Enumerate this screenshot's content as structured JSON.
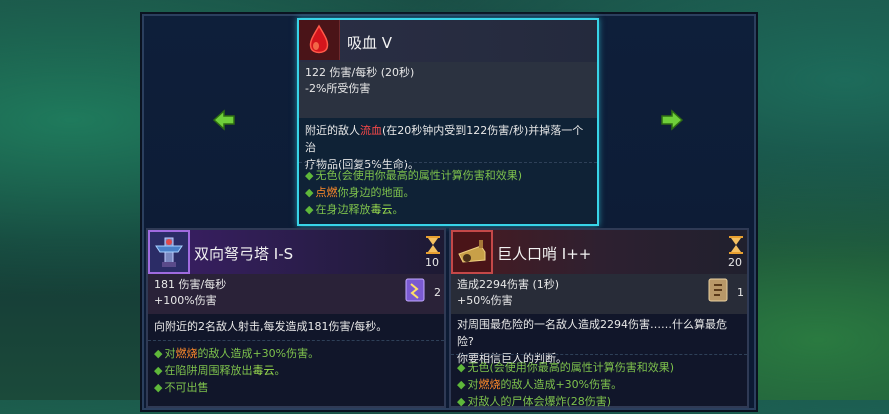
{
  "top_card": {
    "title": "吸血 V",
    "stat_line1": "122 伤害/每秒 (20秒)",
    "stat_line2": "-2%所受伤害",
    "desc_pre": "附近的敌人",
    "desc_hl": "流血",
    "desc_post": "(在20秒钟内受到122伤害/秒)并掉落一个治",
    "desc_line2": "疗物品(回复5%生命)。",
    "effects": [
      {
        "pre": "",
        "hl": "",
        "text": "无色(会使用你最高的属性计算伤害和效果)"
      },
      {
        "pre": "",
        "hl": "点燃",
        "text": "你身边的地面。"
      },
      {
        "pre": "在身边释放",
        "hl": "毒云",
        "text": "。"
      }
    ]
  },
  "bottom_left": {
    "title": "双向弩弓塔 I-S",
    "cooldown": "10",
    "stat_line1": "181 伤害/每秒",
    "stat_line2": "+100%伤害",
    "scroll_count": "2",
    "desc": "向附近的2名敌人射击,每发造成181伤害/每秒。",
    "effects": [
      {
        "pre": "对",
        "hl": "燃烧",
        "text": "的敌人造成+30%伤害。"
      },
      {
        "pre": "在陷阱周围释放出",
        "hl": "毒云",
        "text": "。"
      },
      {
        "pre": "不可出售",
        "hl": "",
        "text": ""
      }
    ]
  },
  "bottom_right": {
    "title": "巨人口哨 I++",
    "cooldown": "20",
    "stat_line1": "造成2294伤害 (1秒)",
    "stat_line2": "+50%伤害",
    "scroll_count": "1",
    "desc_line1": "对周围最危险的一名敌人造成2294伤害……什么算最危险?",
    "desc_line2": "你要相信巨人的判断。",
    "effects": [
      {
        "pre": "无色(会使用你最高的属性计算伤害和效果)",
        "hl": "",
        "text": ""
      },
      {
        "pre": "对",
        "hl": "燃烧",
        "text": "的敌人造成+30%伤害。"
      },
      {
        "pre": "对敌人的尸体会爆炸(28伤害)",
        "hl": "",
        "text": ""
      }
    ]
  },
  "icons": {
    "left_arrow": "arrow-left-icon",
    "right_arrow": "arrow-right-icon",
    "top_item": "blood-drop-icon",
    "left_item": "crossbow-turret-icon",
    "right_item": "whistle-icon"
  },
  "colors": {
    "rarity_top": "#38d4e8",
    "bleed": "#ff4a4a",
    "burn": "#ff8a2a",
    "poison": "#9ce04e",
    "effect_text": "#7ec24c"
  }
}
